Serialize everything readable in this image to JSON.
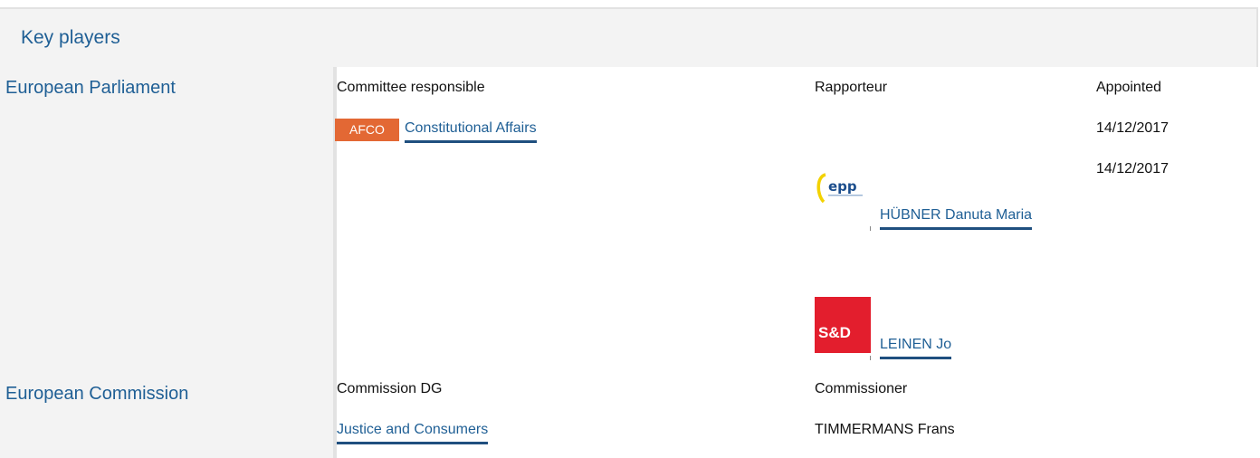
{
  "header": {
    "title": "Key players"
  },
  "parliament": {
    "institution": "European Parliament",
    "committee_label": "Committee responsible",
    "rapporteur_label": "Rapporteur",
    "appointed_label": "Appointed",
    "committee_badge": "AFCO",
    "committee_name": "Constitutional Affairs",
    "committee_date": "14/12/2017",
    "rapporteurs": [
      {
        "group_logo": "epp-logo",
        "name": "HÜBNER Danuta Maria",
        "date": "14/12/2017"
      },
      {
        "group_logo": "sd-logo",
        "group_logo_text": "S&D",
        "name": "LEINEN Jo"
      }
    ]
  },
  "commission": {
    "institution": "European Commission",
    "dg_label": "Commission DG",
    "commissioner_label": "Commissioner",
    "dg_name": "Justice and Consumers",
    "commissioner_name": "TIMMERMANS Frans"
  },
  "colors": {
    "link": "#1f5f95",
    "badge_afco": "#e36834",
    "sd_red": "#e31e2d",
    "header_bg": "#f3f3f3"
  }
}
